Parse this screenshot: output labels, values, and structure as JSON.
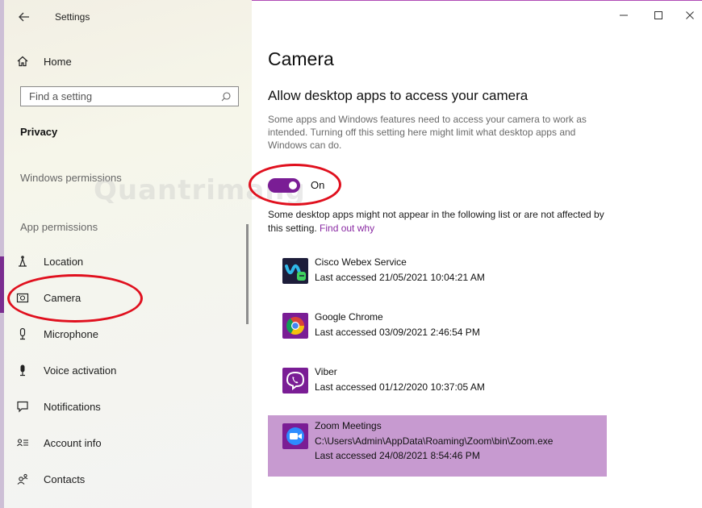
{
  "window": {
    "app_title": "Settings",
    "accent_color": "#7a1d95",
    "selected_row_color": "#c79ad0",
    "annotation_color": "#e0101e"
  },
  "sidebar": {
    "home_label": "Home",
    "search": {
      "placeholder": "Find a setting"
    },
    "section_title": "Privacy",
    "windows_permissions_label": "Windows permissions",
    "app_permissions_label": "App permissions",
    "items": [
      {
        "label": "Location",
        "icon": "location-icon"
      },
      {
        "label": "Camera",
        "icon": "camera-icon",
        "selected": true
      },
      {
        "label": "Microphone",
        "icon": "microphone-icon"
      },
      {
        "label": "Voice activation",
        "icon": "voice-activation-icon"
      },
      {
        "label": "Notifications",
        "icon": "notifications-icon"
      },
      {
        "label": "Account info",
        "icon": "account-info-icon"
      },
      {
        "label": "Contacts",
        "icon": "contacts-icon"
      }
    ]
  },
  "watermark": {
    "text": "uantrimang"
  },
  "main": {
    "page_title": "Camera",
    "heading": "Allow desktop apps to access your camera",
    "description": "Some apps and Windows features need to access your camera to work as intended. Turning off this setting here might limit what desktop apps and Windows can do.",
    "toggle": {
      "state": "On",
      "on": true
    },
    "note_text": "Some desktop apps might not appear in the following list or are not affected by this setting. ",
    "note_link": "Find out why",
    "apps": [
      {
        "name": "Cisco Webex Service",
        "last_accessed": "Last accessed 21/05/2021 10:04:21 AM",
        "icon": "cisco-webex-icon"
      },
      {
        "name": "Google Chrome",
        "last_accessed": "Last accessed 03/09/2021 2:46:54 PM",
        "icon": "google-chrome-icon"
      },
      {
        "name": "Viber",
        "last_accessed": "Last accessed 01/12/2020 10:37:05 AM",
        "icon": "viber-icon"
      },
      {
        "name": "Zoom Meetings",
        "path": "C:\\Users\\Admin\\AppData\\Roaming\\Zoom\\bin\\Zoom.exe",
        "last_accessed": "Last accessed 24/08/2021 8:54:46 PM",
        "icon": "zoom-icon",
        "selected": true
      }
    ]
  }
}
